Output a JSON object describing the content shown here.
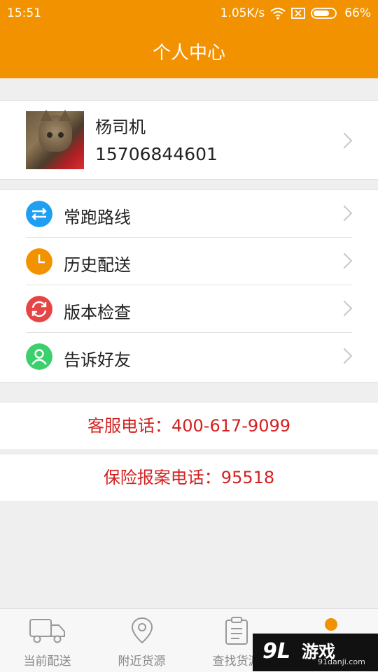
{
  "status_bar": {
    "time": "15:51",
    "network_speed": "1.05K/s",
    "battery": "66%",
    "icons": [
      "wifi-icon",
      "sim-disabled-icon",
      "battery-icon"
    ]
  },
  "header": {
    "title": "个人中心"
  },
  "profile": {
    "name": "杨司机",
    "phone": "15706844601"
  },
  "menu": [
    {
      "label": "常跑路线",
      "icon": "swap-arrows-icon",
      "color": "#1e9ff2"
    },
    {
      "label": "历史配送",
      "icon": "clock-icon",
      "color": "#f39200"
    },
    {
      "label": "版本检查",
      "icon": "refresh-icon",
      "color": "#e64545"
    },
    {
      "label": "告诉好友",
      "icon": "person-icon",
      "color": "#3ccf6e"
    }
  ],
  "contacts": {
    "service_phone": "客服电话：400-617-9099",
    "insurance_phone": "保险报案电话：95518"
  },
  "bottom_nav": [
    {
      "label": "当前配送",
      "icon": "truck-icon"
    },
    {
      "label": "附近货源",
      "icon": "location-pin-icon"
    },
    {
      "label": "查找货源",
      "icon": "clipboard-icon"
    },
    {
      "label": "",
      "icon": "person-icon"
    }
  ],
  "watermark": {
    "brand": "游戏",
    "logo": "9L",
    "site": "91danji.com"
  },
  "colors": {
    "accent": "#f39200",
    "alert": "#d32020"
  }
}
